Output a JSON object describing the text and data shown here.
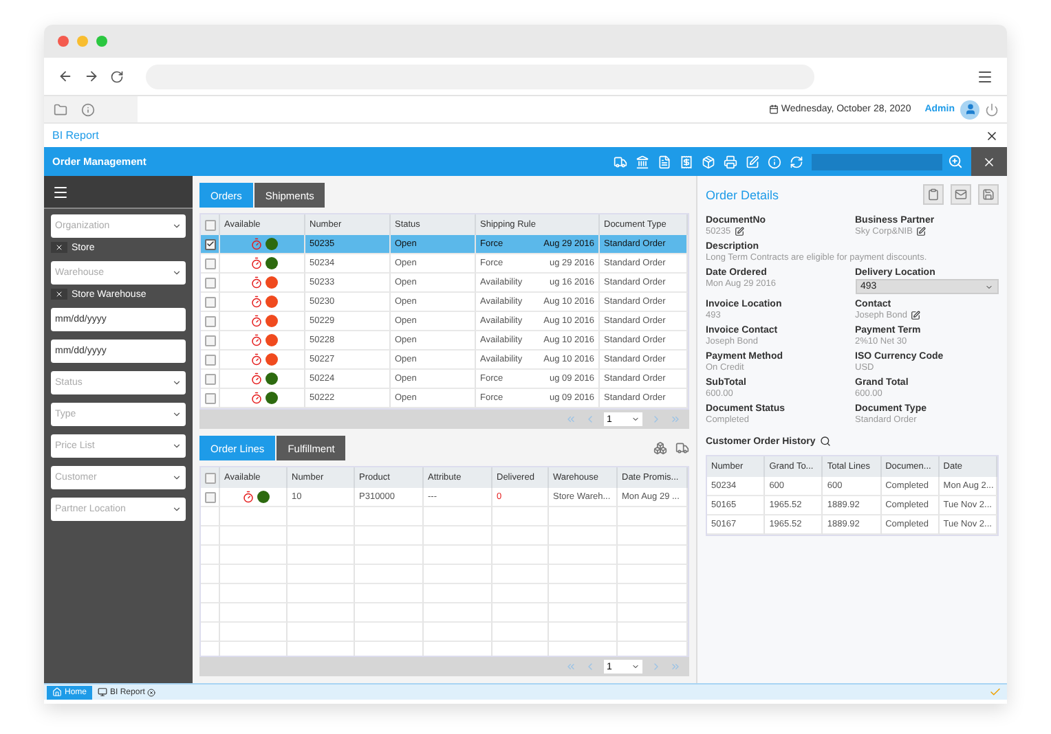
{
  "header": {
    "date": "Wednesday, October 28, 2020",
    "user": "Admin"
  },
  "report_tab": {
    "title": "BI Report"
  },
  "window": {
    "title": "Order Management"
  },
  "sidebar": {
    "filters": [
      {
        "kind": "select",
        "placeholder": "Organization",
        "chip": "Store"
      },
      {
        "kind": "select",
        "placeholder": "Warehouse",
        "chip": "Store Warehouse"
      },
      {
        "kind": "date",
        "value": "mm/dd/yyyy"
      },
      {
        "kind": "date",
        "value": "mm/dd/yyyy"
      },
      {
        "kind": "select",
        "placeholder": "Status"
      },
      {
        "kind": "select",
        "placeholder": "Type"
      },
      {
        "kind": "select",
        "placeholder": "Price List"
      },
      {
        "kind": "select",
        "placeholder": "Customer"
      },
      {
        "kind": "select",
        "placeholder": "Partner Location"
      }
    ]
  },
  "orders": {
    "tabs": [
      {
        "label": "Orders",
        "selected": true
      },
      {
        "label": "Shipments",
        "selected": false
      }
    ],
    "columns": [
      "Available",
      "Number",
      "Status",
      "Shipping Rule",
      "Document Type"
    ],
    "all_checked": false,
    "rows": [
      {
        "selected": true,
        "checked": true,
        "color": "#2d6a0f",
        "number": "50235",
        "status": "Open",
        "rule": "Force",
        "date": "Aug 29 2016",
        "type": "Standard Order"
      },
      {
        "selected": false,
        "checked": false,
        "color": "#2d6a0f",
        "number": "50234",
        "status": "Open",
        "rule": "Force",
        "date": "ug 29 2016",
        "type": "Standard Order"
      },
      {
        "selected": false,
        "checked": false,
        "color": "#f04a1e",
        "number": "50233",
        "status": "Open",
        "rule": "Availability",
        "date": "ug 16 2016",
        "type": "Standard Order"
      },
      {
        "selected": false,
        "checked": false,
        "color": "#f04a1e",
        "number": "50230",
        "status": "Open",
        "rule": "Availability",
        "date": "Aug 10 2016",
        "type": "Standard Order"
      },
      {
        "selected": false,
        "checked": false,
        "color": "#f04a1e",
        "number": "50229",
        "status": "Open",
        "rule": "Availability",
        "date": "Aug 10 2016",
        "type": "Standard Order"
      },
      {
        "selected": false,
        "checked": false,
        "color": "#f04a1e",
        "number": "50228",
        "status": "Open",
        "rule": "Availability",
        "date": "Aug 10 2016",
        "type": "Standard Order"
      },
      {
        "selected": false,
        "checked": false,
        "color": "#f04a1e",
        "number": "50227",
        "status": "Open",
        "rule": "Availability",
        "date": "Aug 10 2016",
        "type": "Standard Order"
      },
      {
        "selected": false,
        "checked": false,
        "color": "#2d6a0f",
        "number": "50224",
        "status": "Open",
        "rule": "Force",
        "date": "ug 09 2016",
        "type": "Standard Order"
      },
      {
        "selected": false,
        "checked": false,
        "color": "#2d6a0f",
        "number": "50222",
        "status": "Open",
        "rule": "Force",
        "date": "ug 09 2016",
        "type": "Standard Order"
      }
    ],
    "page": "1"
  },
  "lines": {
    "tabs": [
      {
        "label": "Order Lines",
        "selected": true
      },
      {
        "label": "Fulfillment",
        "selected": false
      }
    ],
    "columns": [
      "Available",
      "Number",
      "Product",
      "Attribute",
      "Delivered",
      "Warehouse",
      "Date Promis..."
    ],
    "all_checked": false,
    "rows": [
      {
        "checked": false,
        "color": "#2d6a0f",
        "number": "10",
        "product": "P310000",
        "attribute": "---",
        "delivered": "0",
        "warehouse": "Store Wareh...",
        "date_promised": "Mon Aug 29 ..."
      }
    ],
    "page": "1"
  },
  "details": {
    "title": "Order Details",
    "fields": [
      {
        "label": "DocumentNo",
        "value": "50235",
        "kind": "editable"
      },
      {
        "label": "Business Partner",
        "value": "Sky Corp&NIB",
        "kind": "editable"
      },
      {
        "label": "Description",
        "value": "Long Term Contracts are eligible for payment discounts.",
        "kind": "wide"
      },
      {
        "label": "Date Ordered",
        "value": "Mon Aug 29 2016",
        "kind": "text"
      },
      {
        "label": "Delivery Location",
        "value": "493",
        "kind": "select"
      },
      {
        "label": "Invoice Location",
        "value": "493",
        "kind": "text"
      },
      {
        "label": "Contact",
        "value": "Joseph Bond",
        "kind": "editable"
      },
      {
        "label": "Invoice Contact",
        "value": "Joseph Bond",
        "kind": "text"
      },
      {
        "label": "Payment Term",
        "value": "2%10 Net 30",
        "kind": "text"
      },
      {
        "label": "Payment Method",
        "value": "On Credit",
        "kind": "text"
      },
      {
        "label": "ISO Currency Code",
        "value": "USD",
        "kind": "text"
      },
      {
        "label": "SubTotal",
        "value": "600.00",
        "kind": "text"
      },
      {
        "label": "Grand Total",
        "value": "600.00",
        "kind": "text"
      },
      {
        "label": "Document Status",
        "value": "Completed",
        "kind": "text"
      },
      {
        "label": "Document Type",
        "value": "Standard Order",
        "kind": "text"
      }
    ],
    "history": {
      "title": "Customer Order History",
      "columns": [
        "Number",
        "Grand To...",
        "Total Lines",
        "Documen...",
        "Date"
      ],
      "rows": [
        [
          "50234",
          "600",
          "600",
          "Completed",
          "Mon Aug 2..."
        ],
        [
          "50165",
          "1965.52",
          "1889.92",
          "Completed",
          "Tue Nov 2..."
        ],
        [
          "50167",
          "1965.52",
          "1889.92",
          "Completed",
          "Tue Nov 2..."
        ]
      ]
    }
  },
  "taskbar": {
    "tabs": [
      {
        "label": "Home",
        "selected": true
      },
      {
        "label": "BI Report",
        "selected": false
      }
    ]
  }
}
